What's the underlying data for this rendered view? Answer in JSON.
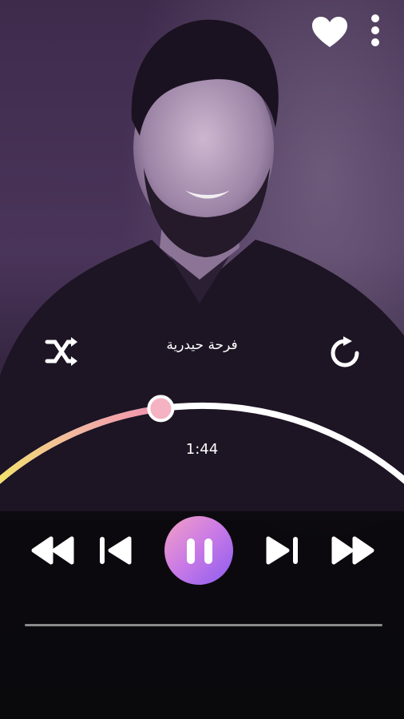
{
  "player": {
    "song_title": "فرحة حيدرية",
    "elapsed_time": "1:44",
    "progress_fraction": 0.41
  },
  "colors": {
    "accent_start": "#f2e46a",
    "accent_mid": "#f08fb0",
    "accent_end": "#c46cf0",
    "tint": "#3a2848",
    "dark": "#0b090d"
  },
  "icons": {
    "favorite": "heart-icon",
    "menu": "more-vertical-icon",
    "shuffle": "shuffle-icon",
    "repeat": "repeat-icon",
    "rewind": "rewind-icon",
    "previous": "skip-previous-icon",
    "play_pause": "pause-icon",
    "next": "skip-next-icon",
    "fast_forward": "fast-forward-icon"
  }
}
